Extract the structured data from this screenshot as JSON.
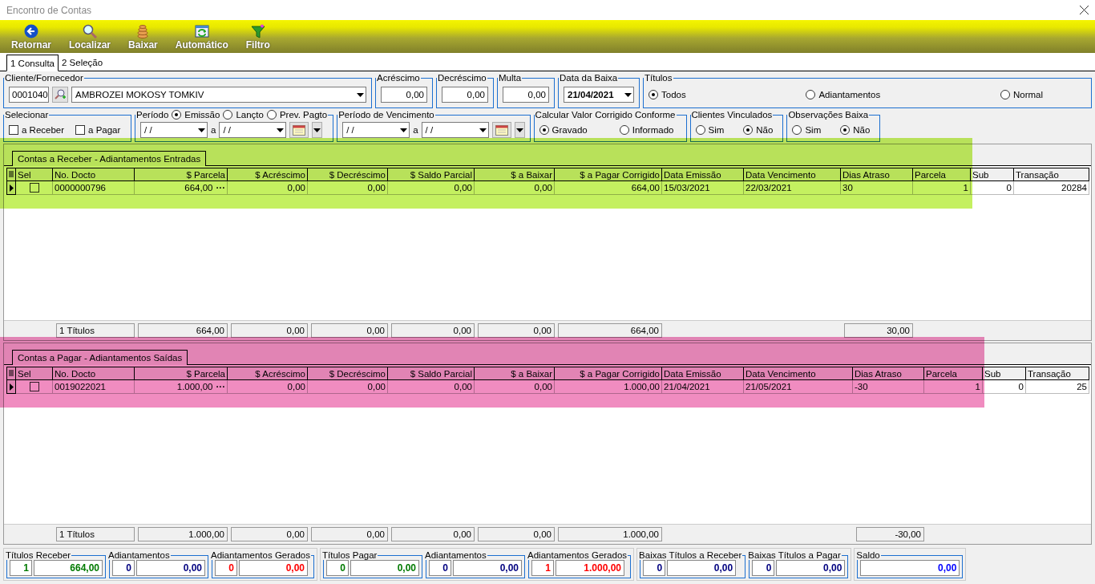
{
  "window": {
    "title": "Encontro de Contas"
  },
  "toolbar": [
    {
      "label": "Retornar",
      "kind": "back"
    },
    {
      "label": "Localizar",
      "kind": "search"
    },
    {
      "label": "Baixar",
      "kind": "coins"
    },
    {
      "label": "Automático",
      "kind": "auto"
    },
    {
      "label": "Filtro",
      "kind": "filter"
    }
  ],
  "tabs": [
    {
      "label": "1 Consulta",
      "selected": true
    },
    {
      "label": "2 Seleção",
      "selected": false
    }
  ],
  "cliente": {
    "legend": "Cliente/Fornecedor",
    "code": "0001040",
    "name": "AMBROZEI MOKOSY TOMKIV"
  },
  "amounts": [
    {
      "legend": "Acréscimo",
      "value": "0,00"
    },
    {
      "legend": "Decréscimo",
      "value": "0,00"
    },
    {
      "legend": "Multa",
      "value": "0,00"
    }
  ],
  "data_baixa": {
    "legend": "Data da Baixa",
    "value": "21/04/2021"
  },
  "titulos": {
    "legend": "Títulos",
    "options": [
      {
        "label": "Todos",
        "selected": true
      },
      {
        "label": "Adiantamentos",
        "selected": false
      },
      {
        "label": "Normal",
        "selected": false
      }
    ]
  },
  "selecionar": {
    "legend": "Selecionar",
    "options": [
      {
        "label": "a Receber",
        "checked": false
      },
      {
        "label": "a Pagar",
        "checked": false
      }
    ]
  },
  "periodo": {
    "legend": "Período",
    "options": [
      {
        "label": "Emissão",
        "selected": true
      },
      {
        "label": "Lançto",
        "selected": false
      },
      {
        "label": "Prev. Pagto",
        "selected": false
      }
    ],
    "from": "/ /",
    "sep": "a",
    "to": "/ /"
  },
  "periodo_vencimento": {
    "legend": "Período de Vencimento",
    "from": "/ /",
    "sep": "a",
    "to": "/ /"
  },
  "radio_groups": [
    {
      "legend": "Calcular Valor Corrigido Conforme",
      "options": [
        {
          "label": "Gravado",
          "selected": true
        },
        {
          "label": "Informado",
          "selected": false
        }
      ]
    },
    {
      "legend": "Clientes Vinculados",
      "options": [
        {
          "label": "Sim",
          "selected": false
        },
        {
          "label": "Não",
          "selected": true
        }
      ]
    },
    {
      "legend": "Observações Baixa",
      "options": [
        {
          "label": "Sim",
          "selected": false
        },
        {
          "label": "Não",
          "selected": true
        }
      ]
    }
  ],
  "panels": [
    {
      "tab": "Contas a Receber - Adiantamentos Entradas",
      "color": "#c4f060",
      "sel_column": "Sel",
      "columns": [
        "No. Docto",
        "$ Parcela",
        "$ Acréscimo",
        "$ Decréscimo",
        "$ Saldo Parcial",
        "$ a Baixar",
        "$ a Pagar Corrigido",
        "Data Emissão",
        "Data Vencimento",
        "Dias Atraso",
        "Parcela",
        "Sub",
        "Transação"
      ],
      "rows": [
        {
          "current": true,
          "checked": false,
          "ellipsis": "···",
          "cells": [
            "0000000796",
            "664,00",
            "0,00",
            "0,00",
            "0,00",
            "0,00",
            "664,00",
            "15/03/2021",
            "22/03/2021",
            "30",
            "1",
            "0",
            "20284"
          ]
        }
      ],
      "totals": {
        "count": "1 Títulos",
        "values": [
          "664,00",
          "0,00",
          "0,00",
          "0,00",
          "0,00",
          "664,00"
        ],
        "dias_atraso": "30,00"
      }
    },
    {
      "tab": "Contas a Pagar - Adiantamentos Saídas",
      "color": "#f08cc0",
      "sel_column": "Sel",
      "columns": [
        "No. Docto",
        "$ Parcela",
        "$ Acréscimo",
        "$ Decréscimo",
        "$ Saldo Parcial",
        "$ a Baixar",
        "$ a Pagar Corrigido",
        "Data Emissão",
        "Data Vencimento",
        "Dias Atraso",
        "Parcela",
        "Sub",
        "Transação"
      ],
      "rows": [
        {
          "current": true,
          "checked": false,
          "ellipsis": "···",
          "cells": [
            "0019022021",
            "1.000,00",
            "0,00",
            "0,00",
            "0,00",
            "0,00",
            "1.000,00",
            "21/04/2021",
            "21/05/2021",
            "-30",
            "1",
            "0",
            "25"
          ]
        }
      ],
      "totals": {
        "count": "1 Títulos",
        "values": [
          "1.000,00",
          "0,00",
          "0,00",
          "0,00",
          "0,00",
          "1.000,00"
        ],
        "dias_atraso": "-30,00"
      }
    }
  ],
  "summary": [
    {
      "items": [
        {
          "legend": "Títulos Receber",
          "count": "1",
          "value": "664,00",
          "color": "#007a00"
        },
        {
          "legend": "Adiantamentos",
          "count": "0",
          "value": "0,00",
          "color": "#000080"
        },
        {
          "legend": "Adiantamentos Gerados",
          "count": "0",
          "value": "0,00",
          "color": "#ff0000"
        }
      ]
    },
    {
      "items": [
        {
          "legend": "Títulos Pagar",
          "count": "0",
          "value": "0,00",
          "color": "#007a00"
        },
        {
          "legend": "Adiantamentos",
          "count": "0",
          "value": "0,00",
          "color": "#000080"
        },
        {
          "legend": "Adiantamentos Gerados",
          "count": "1",
          "value": "1.000,00",
          "color": "#ff0000"
        }
      ]
    },
    {
      "items": [
        {
          "legend": "Baixas Títulos a Receber",
          "count": "0",
          "value": "0,00",
          "color": "#000080"
        },
        {
          "legend": "Baixas Títulos a Pagar",
          "count": "0",
          "value": "0,00",
          "color": "#000080"
        }
      ]
    },
    {
      "items": [
        {
          "legend": "Saldo",
          "value": "0,00",
          "color": "#0000ff"
        }
      ]
    }
  ]
}
